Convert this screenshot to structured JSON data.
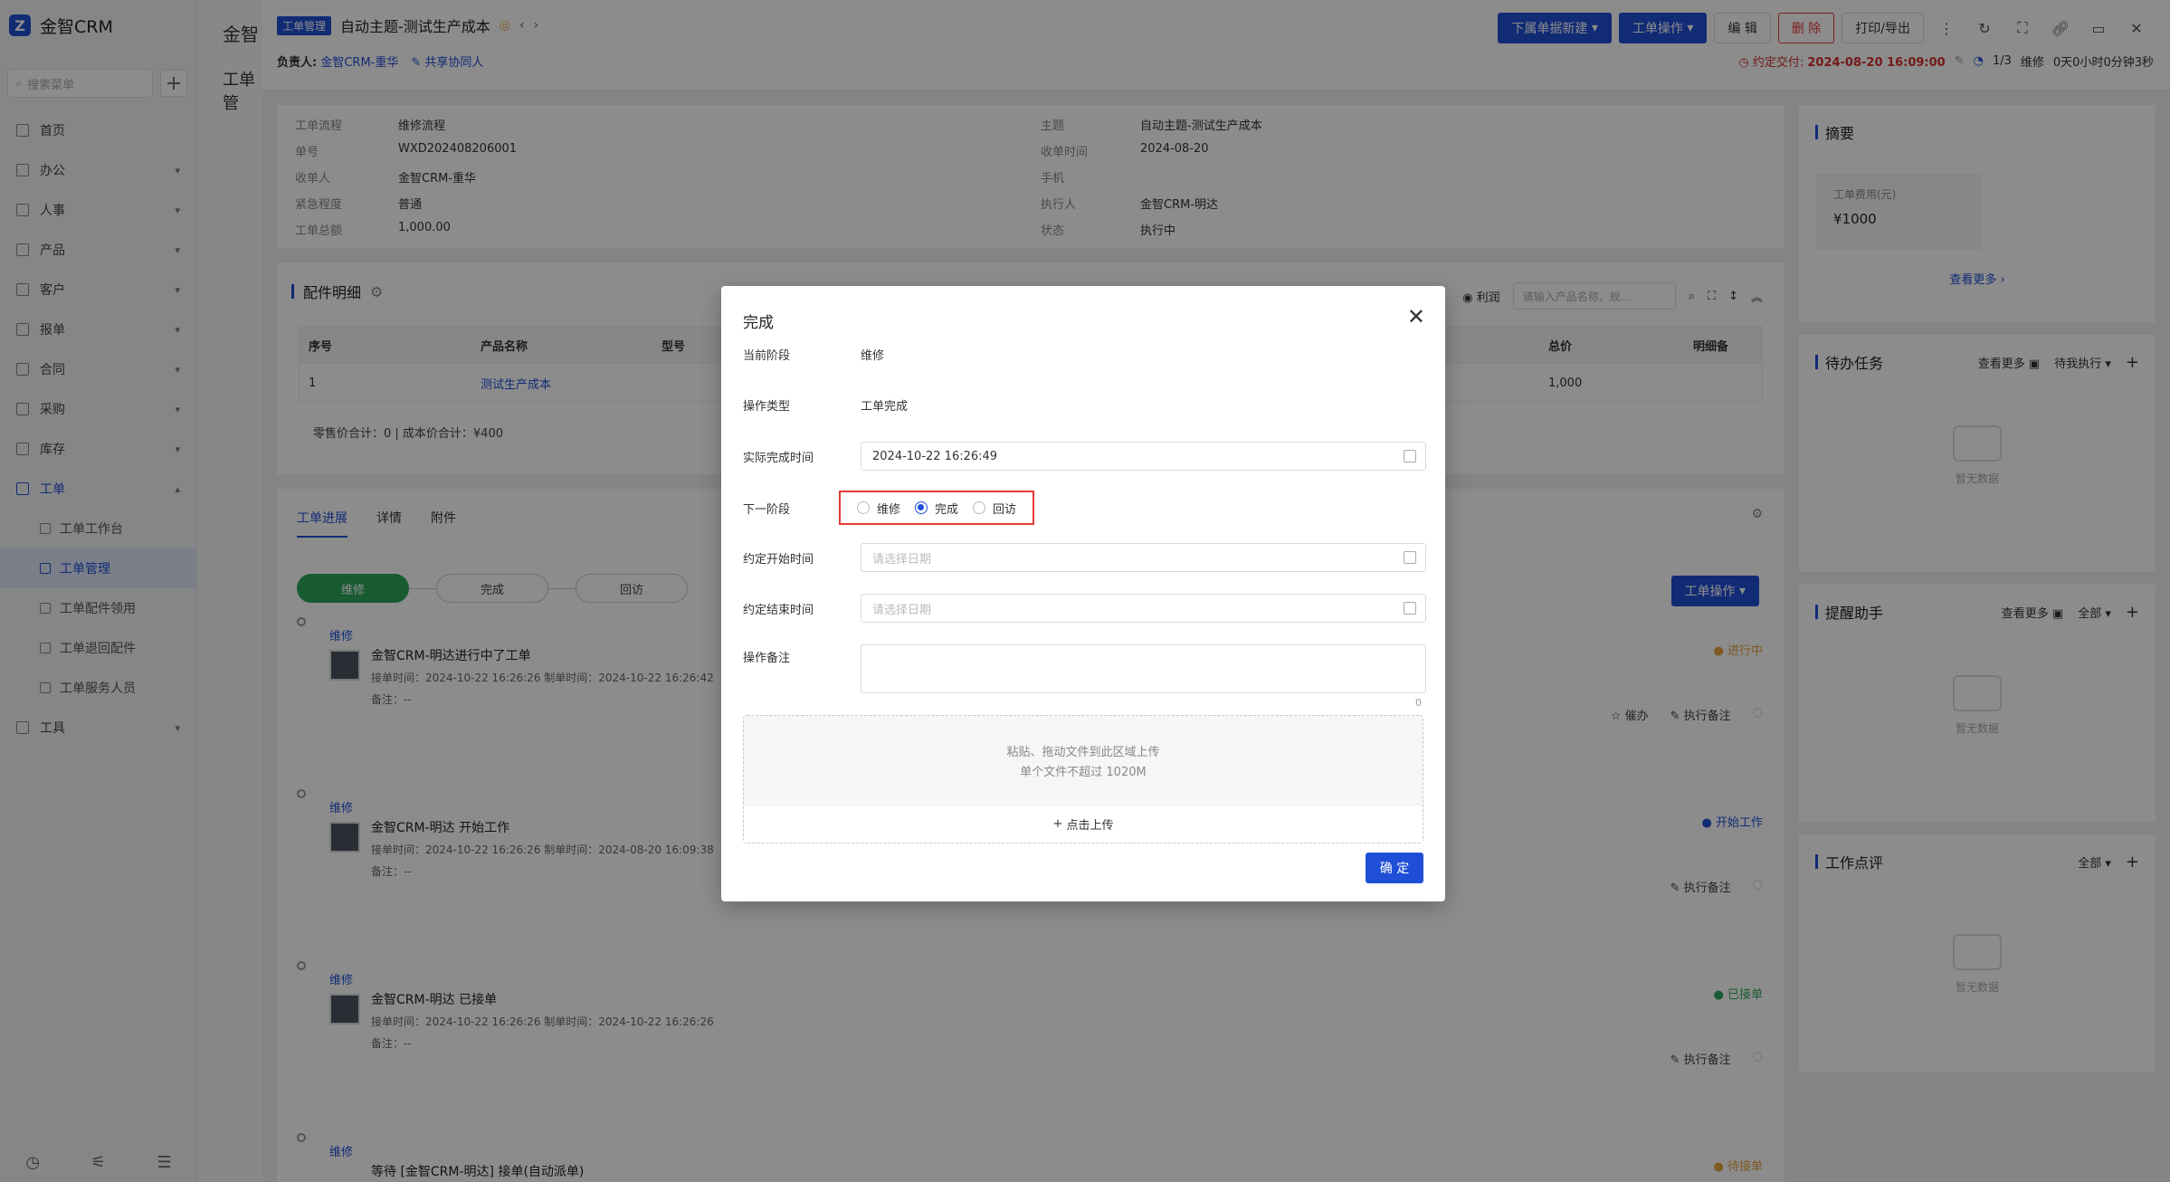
{
  "sidebar": {
    "brand": "金智CRM",
    "search_placeholder": "搜索菜单",
    "items": [
      {
        "label": "首页"
      },
      {
        "label": "办公"
      },
      {
        "label": "人事"
      },
      {
        "label": "产品"
      },
      {
        "label": "客户"
      },
      {
        "label": "报单"
      },
      {
        "label": "合同"
      },
      {
        "label": "采购"
      },
      {
        "label": "库存"
      },
      {
        "label": "工单"
      }
    ],
    "submenu": [
      {
        "label": "工单工作台"
      },
      {
        "label": "工单管理"
      },
      {
        "label": "工单配件领用"
      },
      {
        "label": "工单退回配件"
      },
      {
        "label": "工单服务人员"
      }
    ],
    "tools": {
      "label": "工具"
    }
  },
  "list_panel": {
    "title": "金智",
    "sub": "工单管"
  },
  "header": {
    "tag": "工单管理",
    "title": "自动主题-测试生产成本",
    "owner_label": "负责人:",
    "owner": "金智CRM-重华",
    "share": "共享协同人",
    "buttons": {
      "new_sub": "下属单据新建",
      "ops": "工单操作",
      "edit": "编 辑",
      "delete": "删 除",
      "print": "打印/导出"
    },
    "deadline_label": "约定交付:",
    "deadline": "2024-08-20 16:09:00",
    "progress": "1/3",
    "stage": "维修",
    "elapsed": "0天0小时0分钟3秒"
  },
  "info": {
    "rows": [
      {
        "l1": "工单流程",
        "v1": "维修流程",
        "l2": "主题",
        "v2": "自动主题-测试生产成本"
      },
      {
        "l1": "单号",
        "v1": "WXD202408206001",
        "l2": "收单时间",
        "v2": "2024-08-20"
      },
      {
        "l1": "收单人",
        "v1": "金智CRM-重华",
        "l2": "手机",
        "v2": ""
      },
      {
        "l1": "紧急程度",
        "v1": "普通",
        "l2": "执行人",
        "v2": "金智CRM-明达"
      },
      {
        "l1": "工单总额",
        "v1": "1,000.00",
        "l2": "状态",
        "v2": "执行中"
      }
    ]
  },
  "parts": {
    "title": "配件明细",
    "profit": "利润",
    "search_placeholder": "请输入产品名称、规...",
    "headers": {
      "seq": "序号",
      "name": "产品名称",
      "model": "型号",
      "total": "总价",
      "detail": "明细备"
    },
    "row": {
      "seq": "1",
      "name": "测试生产成本",
      "total": "1,000"
    },
    "summary": "零售价合计：0 | 成本价合计：¥400"
  },
  "progress": {
    "tabs": [
      "工单进展",
      "详情",
      "附件"
    ],
    "stages": [
      "维修",
      "完成",
      "回访"
    ],
    "ops_button": "工单操作",
    "items": [
      {
        "stage": "维修",
        "title": "金智CRM-明达进行中了工单",
        "time": "接单时间：2024-10-22 16:26:26   制单时间：2024-10-22 16:26:42",
        "note": "备注：--",
        "status": "进行中",
        "urge": "催办",
        "remark": "执行备注"
      },
      {
        "stage": "维修",
        "title": "金智CRM-明达 开始工作",
        "time": "接单时间：2024-10-22 16:26:26   制单时间：2024-08-20 16:09:38",
        "note": "备注：--",
        "status": "开始工作",
        "remark": "执行备注"
      },
      {
        "stage": "维修",
        "title": "金智CRM-明达 已接单",
        "time": "接单时间：2024-10-22 16:26:26   制单时间：2024-10-22 16:26:26",
        "note": "备注：--",
        "status": "已接单",
        "remark": "执行备注"
      },
      {
        "stage": "维修",
        "title": "等待 [金智CRM-明达] 接单(自动派单)",
        "status": "待接单"
      }
    ]
  },
  "right": {
    "summary": {
      "title": "摘要",
      "fee_label": "工单费用(元)",
      "fee": "¥1000",
      "more": "查看更多"
    },
    "todo": {
      "title": "待办任务",
      "more": "查看更多",
      "filter": "待我执行",
      "empty": "暂无数据"
    },
    "reminder": {
      "title": "提醒助手",
      "more": "查看更多",
      "filter": "全部",
      "empty": "暂无数据"
    },
    "review": {
      "title": "工作点评",
      "filter": "全部",
      "empty": "暂无数据"
    }
  },
  "modal": {
    "title": "完成",
    "current_stage_label": "当前阶段",
    "current_stage": "维修",
    "op_type_label": "操作类型",
    "op_type": "工单完成",
    "actual_time_label": "实际完成时间",
    "actual_time": "2024-10-22 16:26:49",
    "next_stage_label": "下一阶段",
    "next_stages": [
      "维修",
      "完成",
      "回访"
    ],
    "selected_next": "完成",
    "start_label": "约定开始时间",
    "end_label": "约定结束时间",
    "date_placeholder": "请选择日期",
    "remark_label": "操作备注",
    "counter": "0",
    "upload_hint1": "粘贴、拖动文件到此区域上传",
    "upload_hint2": "单个文件不超过 1020M",
    "upload_button": "点击上传",
    "confirm": "确 定"
  },
  "colors": {
    "primary": "#1f4fd6",
    "success": "#2ea75a",
    "danger": "#e53935",
    "warning": "#e6a23c"
  }
}
